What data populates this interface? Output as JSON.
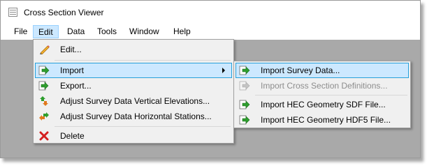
{
  "window": {
    "title": "Cross Section Viewer"
  },
  "menubar": {
    "items": [
      "File",
      "Edit",
      "Data",
      "Tools",
      "Window",
      "Help"
    ],
    "active": "Edit"
  },
  "edit_menu": {
    "items": [
      {
        "label": "Edit...",
        "icon": "pencil-icon"
      },
      {
        "label": "Import",
        "icon": "green-import-arrow-icon",
        "submenu": true,
        "highlighted": true
      },
      {
        "label": "Export...",
        "icon": "green-export-arrow-icon"
      },
      {
        "label": "Adjust Survey Data Vertical Elevations...",
        "icon": "vertical-adjust-arrows-icon"
      },
      {
        "label": "Adjust Survey Data Horizontal Stations...",
        "icon": "horizontal-adjust-arrows-icon"
      },
      {
        "label": "Delete",
        "icon": "red-x-delete-icon"
      }
    ]
  },
  "import_submenu": {
    "items": [
      {
        "label": "Import Survey Data...",
        "icon": "green-import-arrow-icon",
        "highlighted": true,
        "enabled": true
      },
      {
        "label": "Import Cross Section Definitions...",
        "icon": "gray-import-arrow-icon",
        "enabled": false
      },
      {
        "label": "Import HEC Geometry SDF File...",
        "icon": "green-import-arrow-icon",
        "enabled": true
      },
      {
        "label": "Import HEC Geometry HDF5 File...",
        "icon": "green-import-arrow-icon",
        "enabled": true
      }
    ]
  },
  "colors": {
    "highlight_bg": "#cce8ff",
    "highlight_border": "#26a0da",
    "menu_bg": "#f0f0f0",
    "client_bg": "#a9a9a9",
    "disabled_text": "#8d8d8d"
  }
}
